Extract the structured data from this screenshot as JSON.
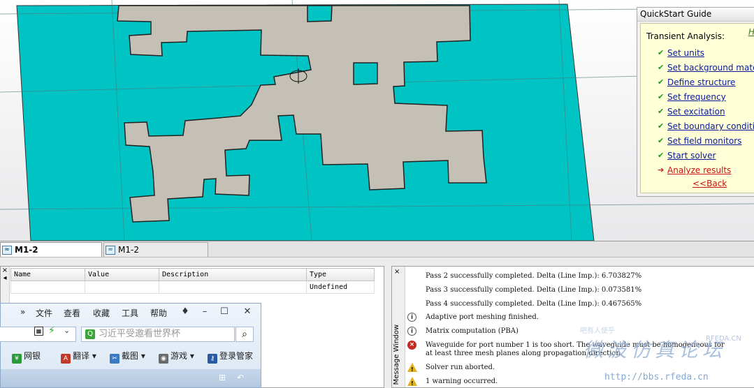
{
  "tabs": [
    {
      "label": "M1-2",
      "active": true
    },
    {
      "label": "M1-2",
      "active": false
    }
  ],
  "quickstart": {
    "title": "QuickStart Guide",
    "heading": "Transient Analysis:",
    "help_link": "H",
    "steps": [
      {
        "label": "Set units",
        "state": "done"
      },
      {
        "label": "Set background mater",
        "state": "done"
      },
      {
        "label": "Define structure",
        "state": "done"
      },
      {
        "label": "Set frequency",
        "state": "done"
      },
      {
        "label": "Set excitation",
        "state": "done"
      },
      {
        "label": "Set boundary condition",
        "state": "done"
      },
      {
        "label": "Set field monitors",
        "state": "done"
      },
      {
        "label": "Start solver",
        "state": "done"
      },
      {
        "label": "Analyze results",
        "state": "active"
      }
    ],
    "back": "<<Back",
    "done_glyph": "✔",
    "active_glyph": "➔"
  },
  "parameters": {
    "columns": [
      "Name",
      "Value",
      "Description",
      "Type"
    ],
    "rows": [
      [
        "",
        "",
        "",
        "Undefined"
      ]
    ],
    "close": "×"
  },
  "messages": {
    "window_title": "Message Window",
    "close": "×",
    "items": [
      {
        "icon": "none",
        "text": "Pass 2 successfully completed. Delta (Line Imp.): 6.703827%"
      },
      {
        "icon": "none",
        "text": "Pass 3 successfully completed. Delta (Line Imp.): 0.073581%"
      },
      {
        "icon": "none",
        "text": "Pass 4 successfully completed. Delta (Line Imp.): 0.467565%"
      },
      {
        "icon": "info",
        "text": "Adaptive port meshing finished."
      },
      {
        "icon": "info",
        "text": "Matrix computation (PBA)"
      },
      {
        "icon": "error",
        "text": "Waveguide for port number 1 is too short. The waveguide must be homogeneous for"
      },
      {
        "icon": "none",
        "text": "at least three mesh planes along propagation direction."
      },
      {
        "icon": "warning",
        "text": "Solver run aborted."
      },
      {
        "icon": "warning",
        "text": "1 warning occurred."
      }
    ]
  },
  "watermark": {
    "cn_title": "微波仿真论坛",
    "url": "http://bbs.rfeda.cn",
    "small": "RFEDA.CN",
    "faint": "吧有人使乎"
  },
  "browser": {
    "menu": [
      "»",
      "文件",
      "查看",
      "收藏",
      "工具",
      "帮助"
    ],
    "search_placeholder": "习近平受邀看世界杯",
    "toolbar": [
      "网银",
      "翻译",
      "截图",
      "游戏",
      "登录管家"
    ]
  },
  "colors": {
    "substrate": "#00c3c3",
    "patch": "#c4c0b6",
    "link": "#0a1a9a",
    "active_link": "#cc1111"
  }
}
